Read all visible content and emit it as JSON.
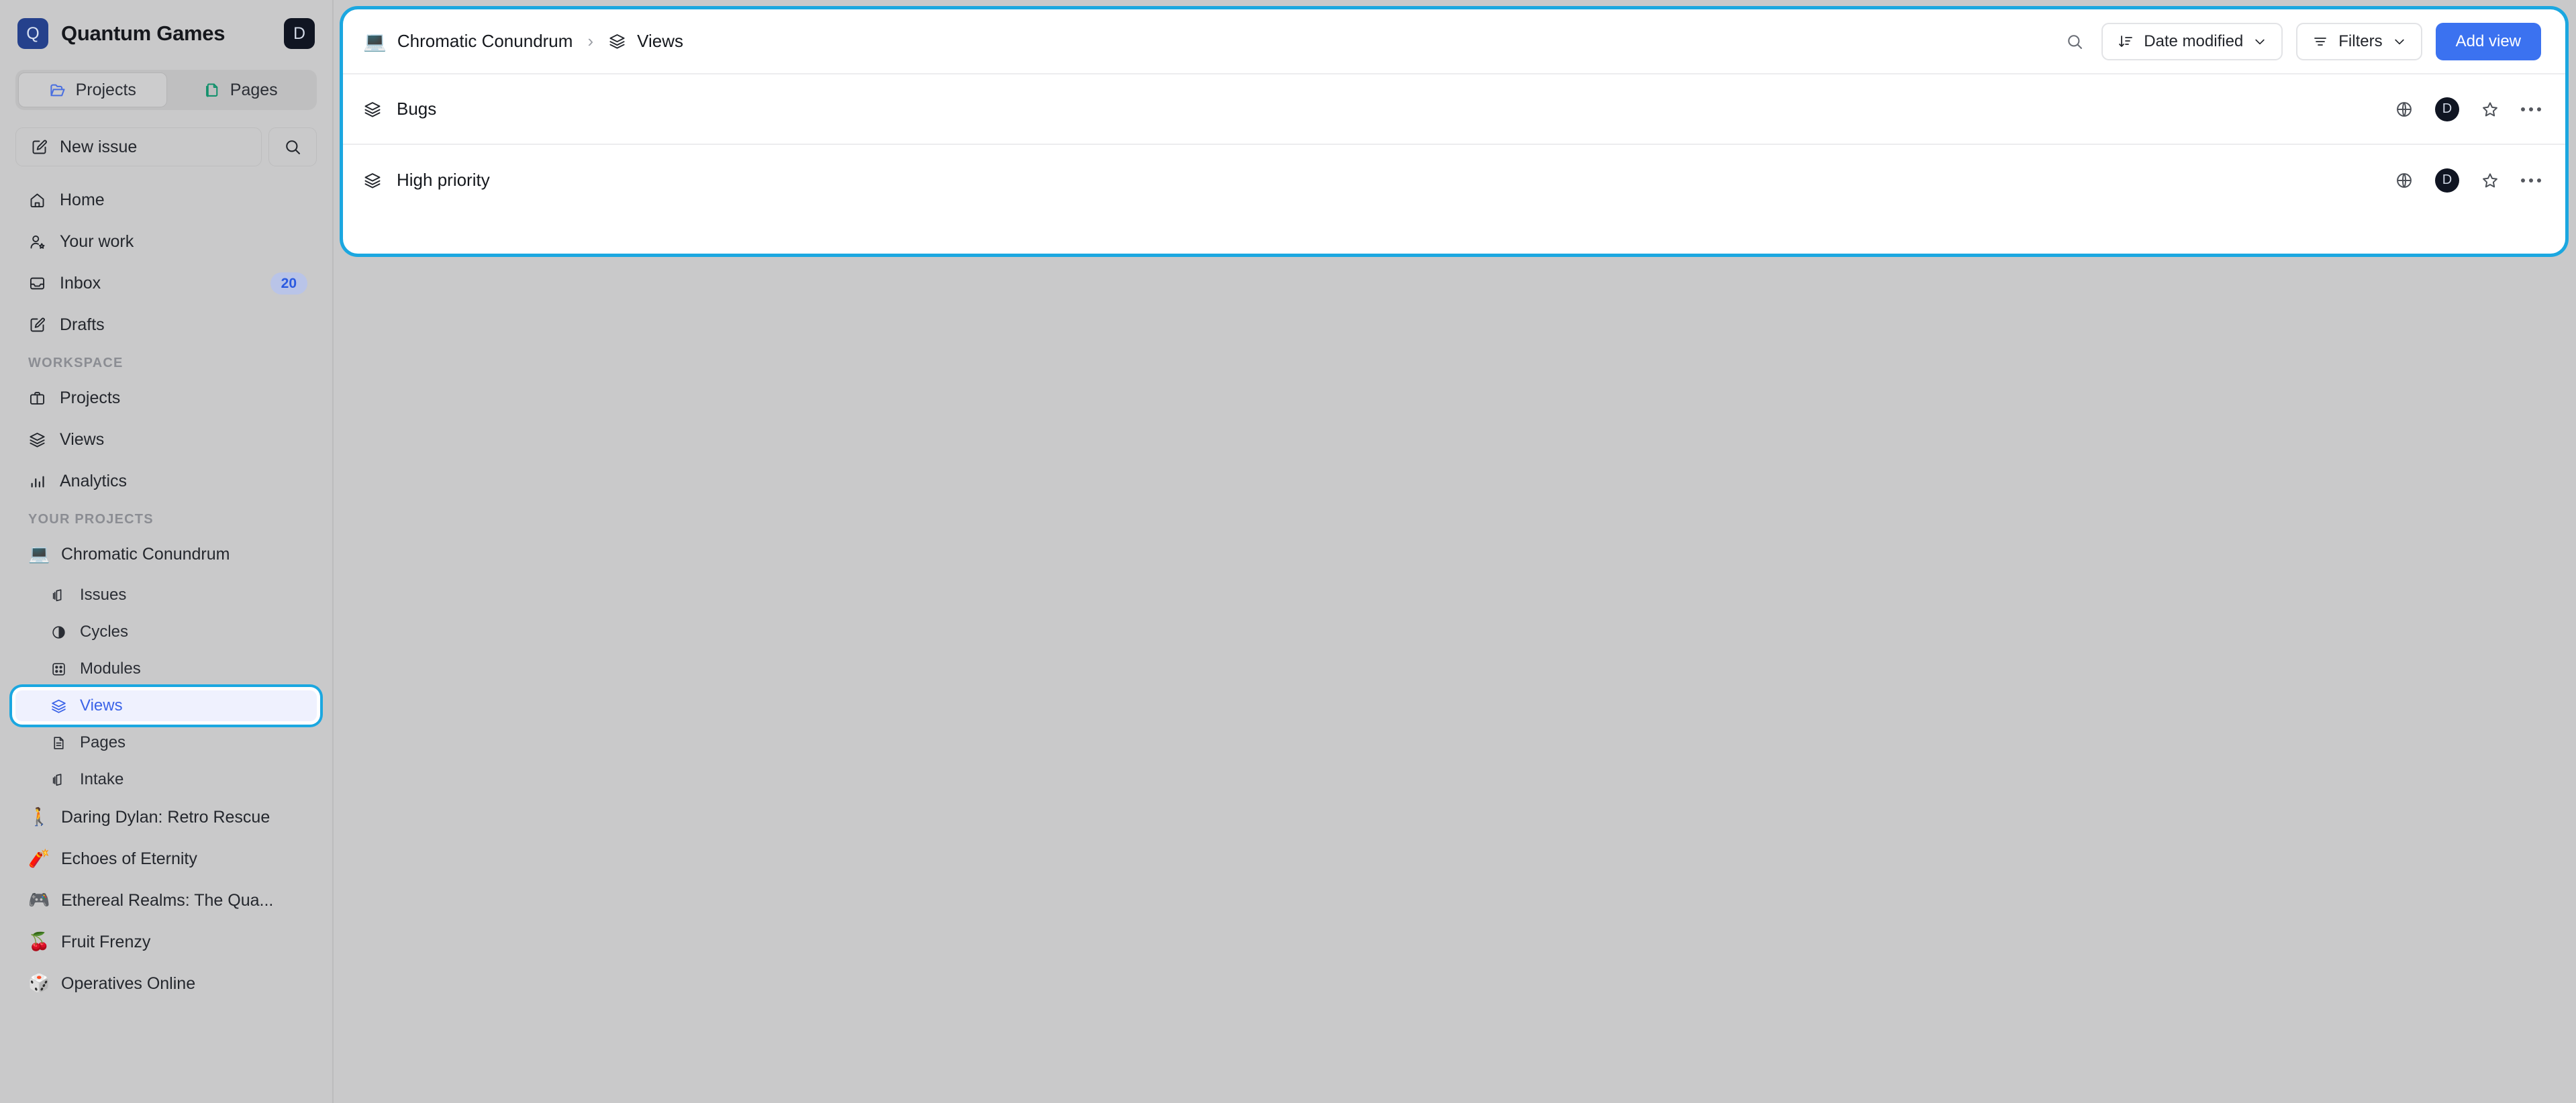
{
  "workspace": {
    "logo_letter": "Q",
    "name": "Quantum Games",
    "avatar_letter": "D"
  },
  "segments": [
    {
      "label": "Projects",
      "icon": "folder-open-icon",
      "active": true
    },
    {
      "label": "Pages",
      "icon": "copy-document-icon",
      "active": false
    }
  ],
  "actions": {
    "new_issue_label": "New issue",
    "new_issue_icon": "edit-square-icon",
    "search_icon": "search-icon"
  },
  "nav": [
    {
      "label": "Home",
      "icon": "home-icon",
      "badge": null
    },
    {
      "label": "Your work",
      "icon": "user-star-icon",
      "badge": null
    },
    {
      "label": "Inbox",
      "icon": "inbox-icon",
      "badge": "20"
    },
    {
      "label": "Drafts",
      "icon": "edit-square-icon",
      "badge": null
    }
  ],
  "workspace_section": {
    "label": "WORKSPACE",
    "items": [
      {
        "label": "Projects",
        "icon": "briefcase-icon"
      },
      {
        "label": "Views",
        "icon": "layers-icon"
      },
      {
        "label": "Analytics",
        "icon": "bar-chart-icon"
      }
    ]
  },
  "projects_section": {
    "label": "YOUR PROJECTS",
    "items": [
      {
        "label": "Chromatic Conundrum",
        "emoji": "💻",
        "expanded": true
      },
      {
        "label": "Daring Dylan: Retro Rescue",
        "emoji": "🚶",
        "expanded": false
      },
      {
        "label": "Echoes of Eternity",
        "emoji": "🧨",
        "expanded": false
      },
      {
        "label": "Ethereal Realms: The Qua...",
        "emoji": "🎮",
        "expanded": false
      },
      {
        "label": "Fruit Frenzy",
        "emoji": "🍒",
        "expanded": false
      },
      {
        "label": "Operatives Online",
        "emoji": "🎲",
        "expanded": false
      }
    ],
    "sub_items": [
      {
        "label": "Issues",
        "icon": "issues-icon",
        "active": false
      },
      {
        "label": "Cycles",
        "icon": "cycle-icon",
        "active": false
      },
      {
        "label": "Modules",
        "icon": "modules-icon",
        "active": false
      },
      {
        "label": "Views",
        "icon": "layers-icon",
        "active": true
      },
      {
        "label": "Pages",
        "icon": "page-icon",
        "active": false
      },
      {
        "label": "Intake",
        "icon": "intake-icon",
        "active": false
      }
    ]
  },
  "panel": {
    "breadcrumb": {
      "project_emoji": "💻",
      "project_label": "Chromatic Conundrum",
      "separator": "›",
      "current_icon": "layers-icon",
      "current_label": "Views"
    },
    "toolbar": {
      "search_icon": "search-icon",
      "sort_icon": "sort-descending-icon",
      "sort_label": "Date modified",
      "sort_chevron": "chevron-down-icon",
      "filters_icon": "filter-icon",
      "filters_label": "Filters",
      "filters_chevron": "chevron-down-icon",
      "add_view_label": "Add view"
    },
    "rows": [
      {
        "name": "Bugs",
        "icon": "layers-icon",
        "access_icon": "globe-icon",
        "avatar_letter": "D",
        "favorite_icon": "star-icon",
        "menu_icon": "more-horizontal-icon"
      },
      {
        "name": "High priority",
        "icon": "layers-icon",
        "access_icon": "globe-icon",
        "avatar_letter": "D",
        "favorite_icon": "star-icon",
        "menu_icon": "more-horizontal-icon"
      }
    ]
  },
  "colors": {
    "accent_blue": "#3b72f0",
    "focus_ring_cyan": "#1ba7e0",
    "logo_navy": "#25418c",
    "active_text_blue": "#3b63e8",
    "badge_blue": "#2b5ae0",
    "page_bg": "#c9c9ca"
  }
}
